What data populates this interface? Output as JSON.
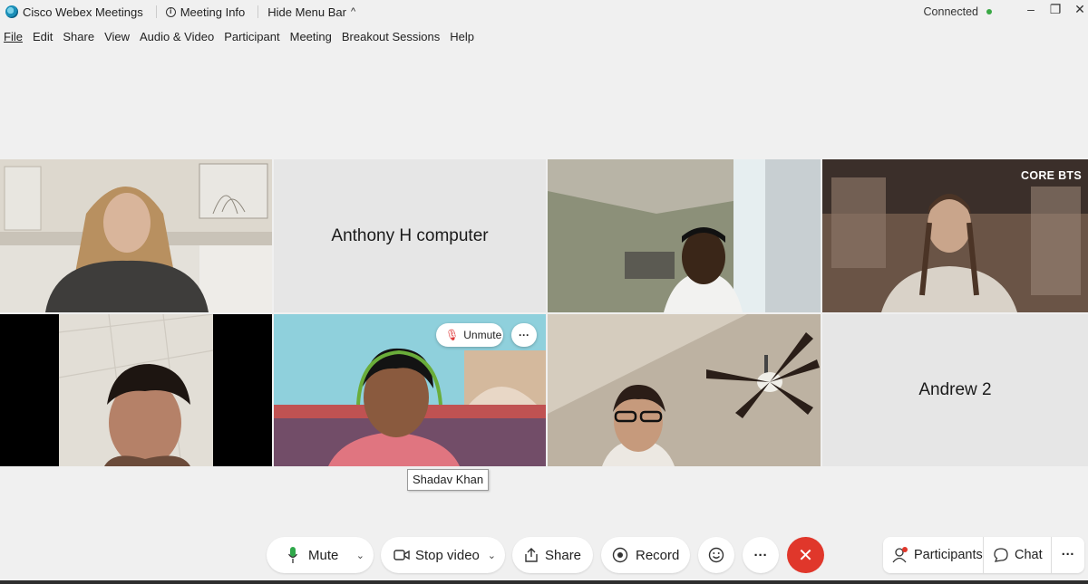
{
  "titlebar": {
    "app_name": "Cisco Webex Meetings",
    "meeting_info": "Meeting Info",
    "hide_menu": "Hide Menu Bar",
    "caret": "^",
    "status": "Connected",
    "status_color": "#3aa845",
    "minimize": "–",
    "restore": "❐",
    "close": "✕"
  },
  "menu": {
    "file": "File",
    "edit": "Edit",
    "share": "Share",
    "view": "View",
    "audio_video": "Audio & Video",
    "participant": "Participant",
    "meeting": "Meeting",
    "breakout": "Breakout Sessions",
    "help": "Help"
  },
  "participants": {
    "anthony": "Anthony H computer",
    "andrew": "Andrew 2"
  },
  "watermark": "CORE BTS",
  "active_tile": {
    "unmute": "Unmute",
    "more": "···",
    "tooltip": "Shadav Khan"
  },
  "controls": {
    "mute": "Mute",
    "stop_video": "Stop video",
    "share": "Share",
    "record": "Record",
    "more": "···",
    "participants": "Participants",
    "chat": "Chat",
    "end_color": "#e0372b"
  }
}
